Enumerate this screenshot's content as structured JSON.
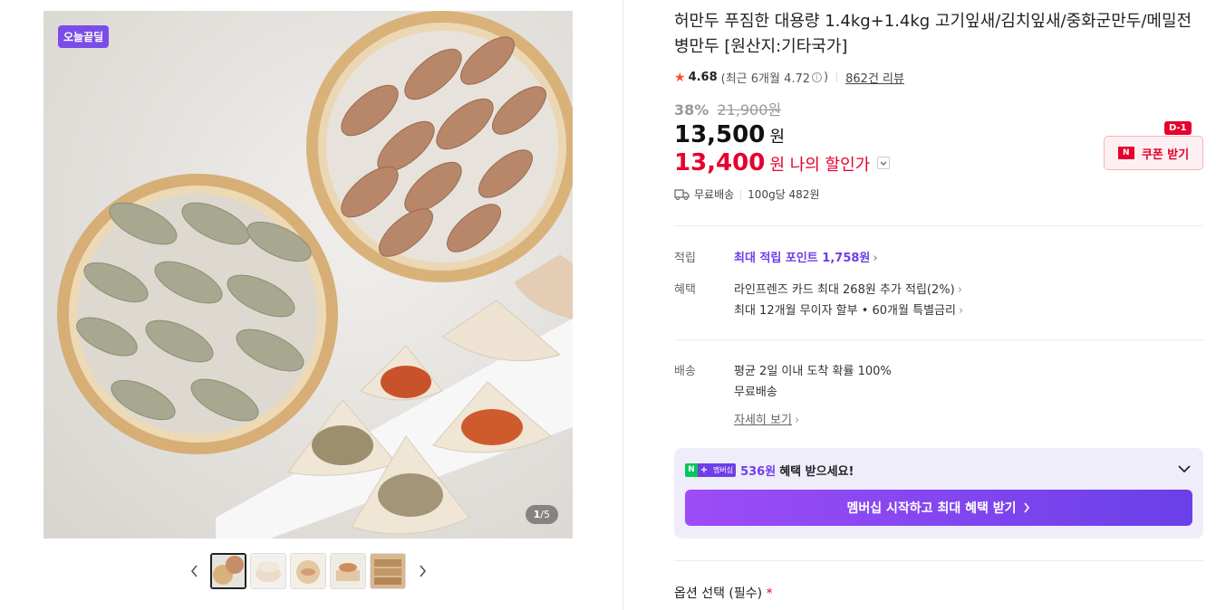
{
  "gallery": {
    "badge": "오늘끝딜",
    "counter_current": "1",
    "counter_total": "/5",
    "thumb_count": 5
  },
  "product": {
    "title": "허만두 푸짐한 대용량 1.4kg+1.4kg 고기잎새/김치잎새/중화군만두/메밀전병만두 [원산지:기타국가]",
    "rating_score": "4.68",
    "rating_recent": "(최근 6개월 4.72",
    "rating_recent_close": ")",
    "review_count": "862건 리뷰",
    "discount_pct": "38%",
    "original_price": "21,900원",
    "price": "13,500",
    "price_unit": "원",
    "my_price": "13,400",
    "my_price_label": "원 나의 할인가",
    "coupon_label": "쿠폰 받기",
    "coupon_dday": "D-1",
    "shipping_free": "무료배송",
    "unit_price": "100g당 482원"
  },
  "details": {
    "points_label": "적립",
    "points_value": "최대 적립 포인트 1,758원",
    "benefit_label": "혜택",
    "benefit_line1": "라인프렌즈 카드 최대 268원 추가 적립(2%)",
    "benefit_line2": "최대 12개월 무이자 할부 • 60개월 특별금리",
    "delivery_label": "배송",
    "delivery_line1": "평균 2일 이내 도착 확률 100%",
    "delivery_line2": "무료배송",
    "delivery_more": "자세히 보기"
  },
  "membership": {
    "pill_text": "멤버십",
    "amount": "536원",
    "rest": "혜택 받으세요!",
    "button": "멤버십 시작하고 최대 혜택 받기"
  },
  "options": {
    "title": "옵션 선택 (필수)",
    "required_mark": "*"
  },
  "colors": {
    "accent_red": "#e6002d",
    "accent_purple": "#6f3ee8",
    "naver_green": "#03c75a"
  }
}
